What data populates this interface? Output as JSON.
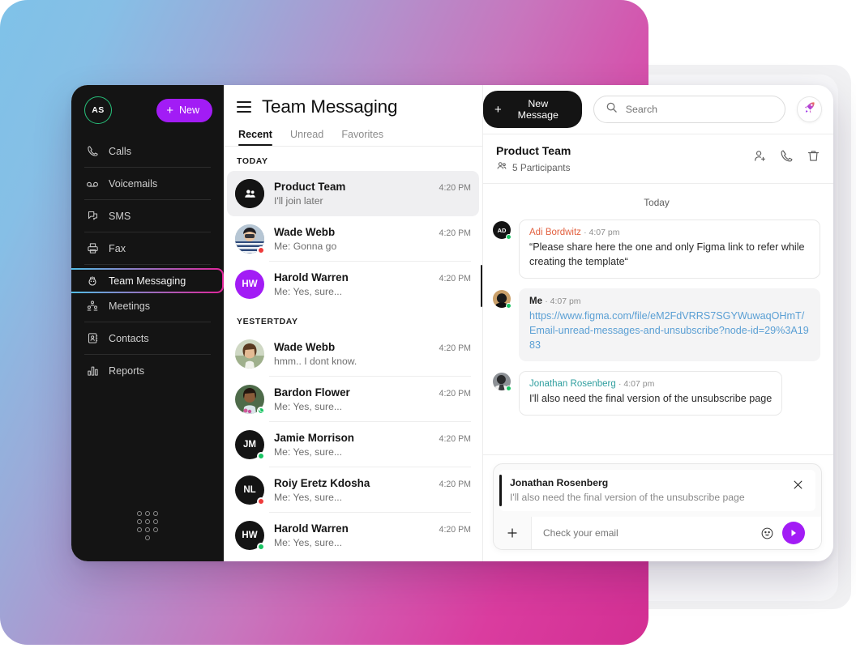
{
  "backdrop": {
    "gradient_from": "#7fc2e8",
    "gradient_to": "#d32f93"
  },
  "sidebar": {
    "avatar_initials": "AS",
    "new_button_label": "New",
    "items": [
      {
        "label": "Calls",
        "icon": "phone-icon",
        "active": false
      },
      {
        "label": "Voicemails",
        "icon": "voicemail-icon",
        "active": false
      },
      {
        "label": "SMS",
        "icon": "sms-icon",
        "active": false
      },
      {
        "label": "Fax",
        "icon": "fax-icon",
        "active": false
      },
      {
        "label": "Team Messaging",
        "icon": "team-messaging-icon",
        "active": true
      },
      {
        "label": "Meetings",
        "icon": "meetings-icon",
        "active": false
      },
      {
        "label": "Contacts",
        "icon": "contacts-icon",
        "active": false
      },
      {
        "label": "Reports",
        "icon": "reports-icon",
        "active": false
      }
    ],
    "dialpad_icon": "dialpad-icon"
  },
  "header": {
    "title": "Team Messaging",
    "menu_icon": "hamburger-icon",
    "new_message_label": "New Message",
    "search_placeholder": "Search",
    "search_value": "",
    "rocket_icon": "rocket-icon"
  },
  "tabs": [
    {
      "label": "Recent",
      "active": true
    },
    {
      "label": "Unread",
      "active": false
    },
    {
      "label": "Favorites",
      "active": false
    }
  ],
  "conversations": {
    "groups": [
      {
        "label": "TODAY",
        "items": [
          {
            "name": "Product Team",
            "preview": "I'll join later",
            "time": "4:20 PM",
            "avatar_type": "group",
            "initials": "",
            "avatar_bg": "#141414",
            "status": "",
            "selected": true
          },
          {
            "name": "Wade Webb",
            "preview": "Me: Gonna go",
            "time": "4:20 PM",
            "avatar_type": "photo-man",
            "initials": "",
            "avatar_bg": "#8fa4b8",
            "status": "red",
            "selected": false
          },
          {
            "name": "Harold Warren",
            "preview": "Me: Yes, sure...",
            "time": "4:20 PM",
            "avatar_type": "initials",
            "initials": "HW",
            "avatar_bg": "#a21cf5",
            "status": "",
            "selected": false
          }
        ]
      },
      {
        "label": "YESTERTDAY",
        "items": [
          {
            "name": "Wade Webb",
            "preview": "hmm.. I dont know.",
            "time": "4:20 PM",
            "avatar_type": "photo-woman",
            "initials": "",
            "avatar_bg": "#b99a78",
            "status": "",
            "selected": false
          },
          {
            "name": "Bardon Flower",
            "preview": "Me: Yes, sure...",
            "time": "4:20 PM",
            "avatar_type": "photo-woman2",
            "initials": "",
            "avatar_bg": "#6b8a6b",
            "status": "call",
            "selected": false
          },
          {
            "name": "Jamie Morrison",
            "preview": "Me: Yes, sure...",
            "time": "4:20 PM",
            "avatar_type": "initials",
            "initials": "JM",
            "avatar_bg": "#141414",
            "status": "green",
            "selected": false
          },
          {
            "name": "Roiy Eretz Kdosha",
            "preview": "Me: Yes, sure...",
            "time": "4:20 PM",
            "avatar_type": "initials",
            "initials": "NL",
            "avatar_bg": "#141414",
            "status": "red",
            "selected": false
          },
          {
            "name": "Harold Warren",
            "preview": "Me: Yes, sure...",
            "time": "4:20 PM",
            "avatar_type": "initials",
            "initials": "HW",
            "avatar_bg": "#141414",
            "status": "green",
            "selected": false
          }
        ]
      }
    ]
  },
  "chat": {
    "title": "Product Team",
    "participants": "5 Participants",
    "participants_icon": "people-icon",
    "actions": [
      {
        "icon": "add-person-icon"
      },
      {
        "icon": "phone-icon"
      },
      {
        "icon": "trash-icon"
      }
    ],
    "day_label": "Today",
    "messages": [
      {
        "author": "Adi Bordwitz",
        "author_color": "red",
        "time": "4:07 pm",
        "text": "“Please share here the one and only Figma link to refer while creating the template“",
        "is_link": false,
        "bubble": "white",
        "avatar_type": "initials",
        "initials": "AD",
        "avatar_bg": "#141414",
        "status": "green"
      },
      {
        "author": "Me",
        "author_color": "dark",
        "time": "4:07 pm",
        "text": "https://www.figma.com/file/eM2FdVRRS7SGYWuwaqOHmT/Email-unread-messages-and-unsubscribe?node-id=29%3A1983",
        "is_link": true,
        "bubble": "gray",
        "avatar_type": "photo-me",
        "initials": "",
        "avatar_bg": "#7a6043",
        "status": "green"
      },
      {
        "author": "Jonathan Rosenberg",
        "author_color": "teal",
        "time": "4:07 pm",
        "text": "I'll also need the final version of the unsubscribe page",
        "is_link": false,
        "bubble": "white",
        "avatar_type": "photo-jon",
        "initials": "",
        "avatar_bg": "#55585c",
        "status": "green"
      }
    ]
  },
  "composer": {
    "reply_name": "Jonathan Rosenberg",
    "reply_text": "I'll also need the final version of the unsubscribe page",
    "close_icon": "close-icon",
    "attach_icon": "plus-icon",
    "input_placeholder": "Check your email",
    "input_value": "",
    "emoji_icon": "emoji-icon",
    "send_icon": "send-icon",
    "send_color": "#a21cf5"
  }
}
